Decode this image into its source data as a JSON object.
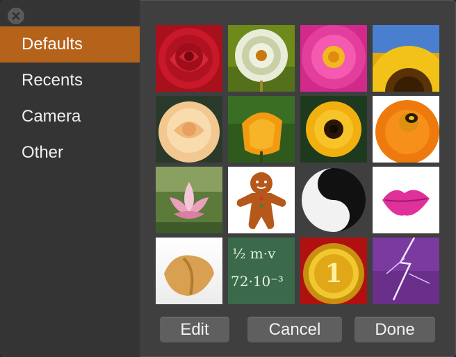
{
  "window": {
    "close_icon": "close-icon"
  },
  "sidebar": {
    "items": [
      {
        "label": "Defaults",
        "selected": true
      },
      {
        "label": "Recents",
        "selected": false
      },
      {
        "label": "Camera",
        "selected": false
      },
      {
        "label": "Other",
        "selected": false
      }
    ],
    "accent_color": "#b5621b"
  },
  "images": [
    {
      "name": "red-rose"
    },
    {
      "name": "dandelion"
    },
    {
      "name": "pink-dahlia"
    },
    {
      "name": "sunflower"
    },
    {
      "name": "peach-rose"
    },
    {
      "name": "orange-poppy"
    },
    {
      "name": "black-eyed-susan"
    },
    {
      "name": "orange-gerbera-with-bee"
    },
    {
      "name": "lotus"
    },
    {
      "name": "gingerbread-man"
    },
    {
      "name": "yin-yang"
    },
    {
      "name": "lips"
    },
    {
      "name": "fortune-cookie"
    },
    {
      "name": "chalkboard-formula",
      "text_top": "½ m·v",
      "text_bottom": "72·10⁻³"
    },
    {
      "name": "gold-medal",
      "text": "1"
    },
    {
      "name": "lightning"
    }
  ],
  "buttons": {
    "edit": "Edit",
    "cancel": "Cancel",
    "done": "Done"
  }
}
